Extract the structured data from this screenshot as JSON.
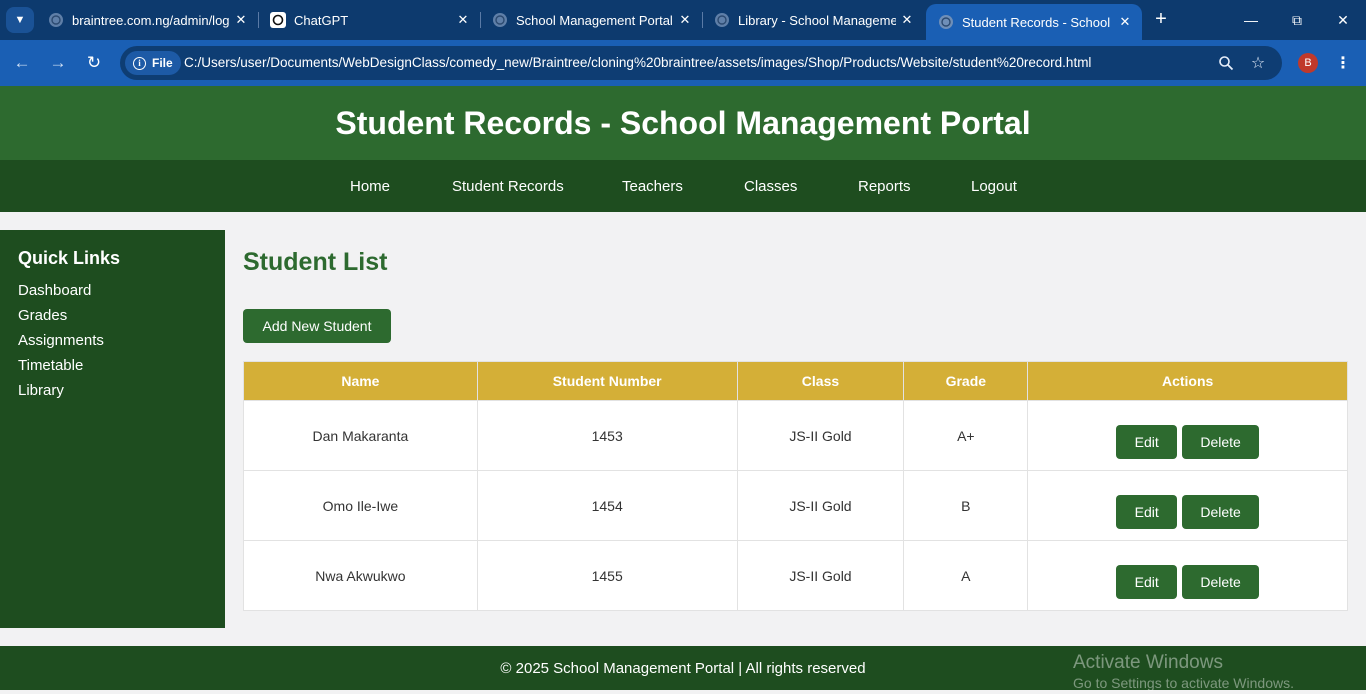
{
  "browser": {
    "tabs": [
      {
        "title": "braintree.com.ng/admin/log",
        "icon": "globe-icon",
        "active": false
      },
      {
        "title": "ChatGPT",
        "icon": "chatgpt-icon",
        "active": false
      },
      {
        "title": "School Management Portal",
        "icon": "globe-icon",
        "active": false
      },
      {
        "title": "Library - School Managemen",
        "icon": "globe-icon",
        "active": false
      },
      {
        "title": "Student Records - School Ma",
        "icon": "globe-icon",
        "active": true
      }
    ],
    "address_chip": "File",
    "url": "C:/Users/user/Documents/WebDesignClass/comedy_new/Braintree/cloning%20braintree/assets/images/Shop/Products/Website/student%20record.html",
    "profile_initial": "B"
  },
  "page": {
    "header_title": "Student Records - School Management Portal",
    "nav": [
      "Home",
      "Student Records",
      "Teachers",
      "Classes",
      "Reports",
      "Logout"
    ],
    "sidebar": {
      "title": "Quick Links",
      "links": [
        "Dashboard",
        "Grades",
        "Assignments",
        "Timetable",
        "Library"
      ]
    },
    "main": {
      "title": "Student List",
      "add_button": "Add New Student",
      "table": {
        "headers": [
          "Name",
          "Student Number",
          "Class",
          "Grade",
          "Actions"
        ],
        "rows": [
          {
            "name": "Dan Makaranta",
            "number": "1453",
            "class": "JS-II Gold",
            "grade": "A+"
          },
          {
            "name": "Omo Ile-Iwe",
            "number": "1454",
            "class": "JS-II Gold",
            "grade": "B"
          },
          {
            "name": "Nwa Akwukwo",
            "number": "1455",
            "class": "JS-II Gold",
            "grade": "A"
          }
        ],
        "edit_label": "Edit",
        "delete_label": "Delete"
      }
    },
    "footer": "© 2025 School Management Portal | All rights reserved"
  },
  "watermark": {
    "line1": "Activate Windows",
    "line2": "Go to Settings to activate Windows."
  },
  "colors": {
    "primary_green": "#2d6a2f",
    "dark_green": "#1e4d1f",
    "gold": "#d4af37",
    "browser_blue": "#1a5fb4"
  }
}
